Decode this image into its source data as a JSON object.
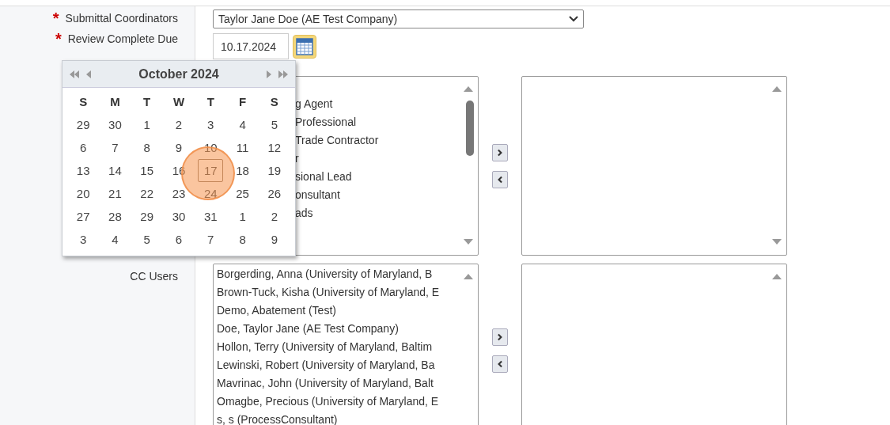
{
  "submittal_coordinators": {
    "label": "Submittal Coordinators",
    "required": true,
    "required_mark": "*",
    "value": "Taylor Jane Doe (AE Test Company)"
  },
  "review_due": {
    "label": "Review Complete Due",
    "required": true,
    "required_mark": "*",
    "value": "10.17.2024"
  },
  "calendar": {
    "title": "October 2024",
    "weekdays": [
      "S",
      "M",
      "T",
      "W",
      "T",
      "F",
      "S"
    ],
    "days": [
      {
        "day": "29",
        "selected": false
      },
      {
        "day": "30",
        "selected": false
      },
      {
        "day": "1",
        "selected": false
      },
      {
        "day": "2",
        "selected": false
      },
      {
        "day": "3",
        "selected": false
      },
      {
        "day": "4",
        "selected": false
      },
      {
        "day": "5",
        "selected": false
      },
      {
        "day": "6",
        "selected": false
      },
      {
        "day": "7",
        "selected": false
      },
      {
        "day": "8",
        "selected": false
      },
      {
        "day": "9",
        "selected": false
      },
      {
        "day": "10",
        "selected": false
      },
      {
        "day": "11",
        "selected": false
      },
      {
        "day": "12",
        "selected": false
      },
      {
        "day": "13",
        "selected": false
      },
      {
        "day": "14",
        "selected": false
      },
      {
        "day": "15",
        "selected": false
      },
      {
        "day": "16",
        "selected": false
      },
      {
        "day": "17",
        "selected": true
      },
      {
        "day": "18",
        "selected": false
      },
      {
        "day": "19",
        "selected": false
      },
      {
        "day": "20",
        "selected": false
      },
      {
        "day": "21",
        "selected": false
      },
      {
        "day": "22",
        "selected": false
      },
      {
        "day": "23",
        "selected": false
      },
      {
        "day": "24",
        "selected": false
      },
      {
        "day": "25",
        "selected": false
      },
      {
        "day": "26",
        "selected": false
      },
      {
        "day": "27",
        "selected": false
      },
      {
        "day": "28",
        "selected": false
      },
      {
        "day": "29",
        "selected": false
      },
      {
        "day": "30",
        "selected": false
      },
      {
        "day": "31",
        "selected": false
      },
      {
        "day": "1",
        "selected": false
      },
      {
        "day": "2",
        "selected": false
      },
      {
        "day": "3",
        "selected": false
      },
      {
        "day": "4",
        "selected": false
      },
      {
        "day": "5",
        "selected": false
      },
      {
        "day": "6",
        "selected": false
      },
      {
        "day": "7",
        "selected": false
      },
      {
        "day": "8",
        "selected": false
      },
      {
        "day": "9",
        "selected": false
      }
    ]
  },
  "roles_list": {
    "items": [
      "g Agent",
      "Professional",
      "Trade Contractor",
      "r",
      "sional Lead",
      "onsultant",
      "ads"
    ]
  },
  "cc_users": {
    "label": "CC Users",
    "items": [
      "Borgerding, Anna (University of Maryland, B",
      "Brown-Tuck, Kisha (University of Maryland, E",
      "Demo, Abatement (Test)",
      "Doe, Taylor Jane (AE Test Company)",
      "Hollon, Terry (University of Maryland, Baltim",
      "Lewinski, Robert (University of Maryland, Ba",
      "Mavrinac, John (University of Maryland, Balt",
      "Omagbe, Precious (University of Maryland, E",
      "s, s (ProcessConsultant)"
    ]
  }
}
